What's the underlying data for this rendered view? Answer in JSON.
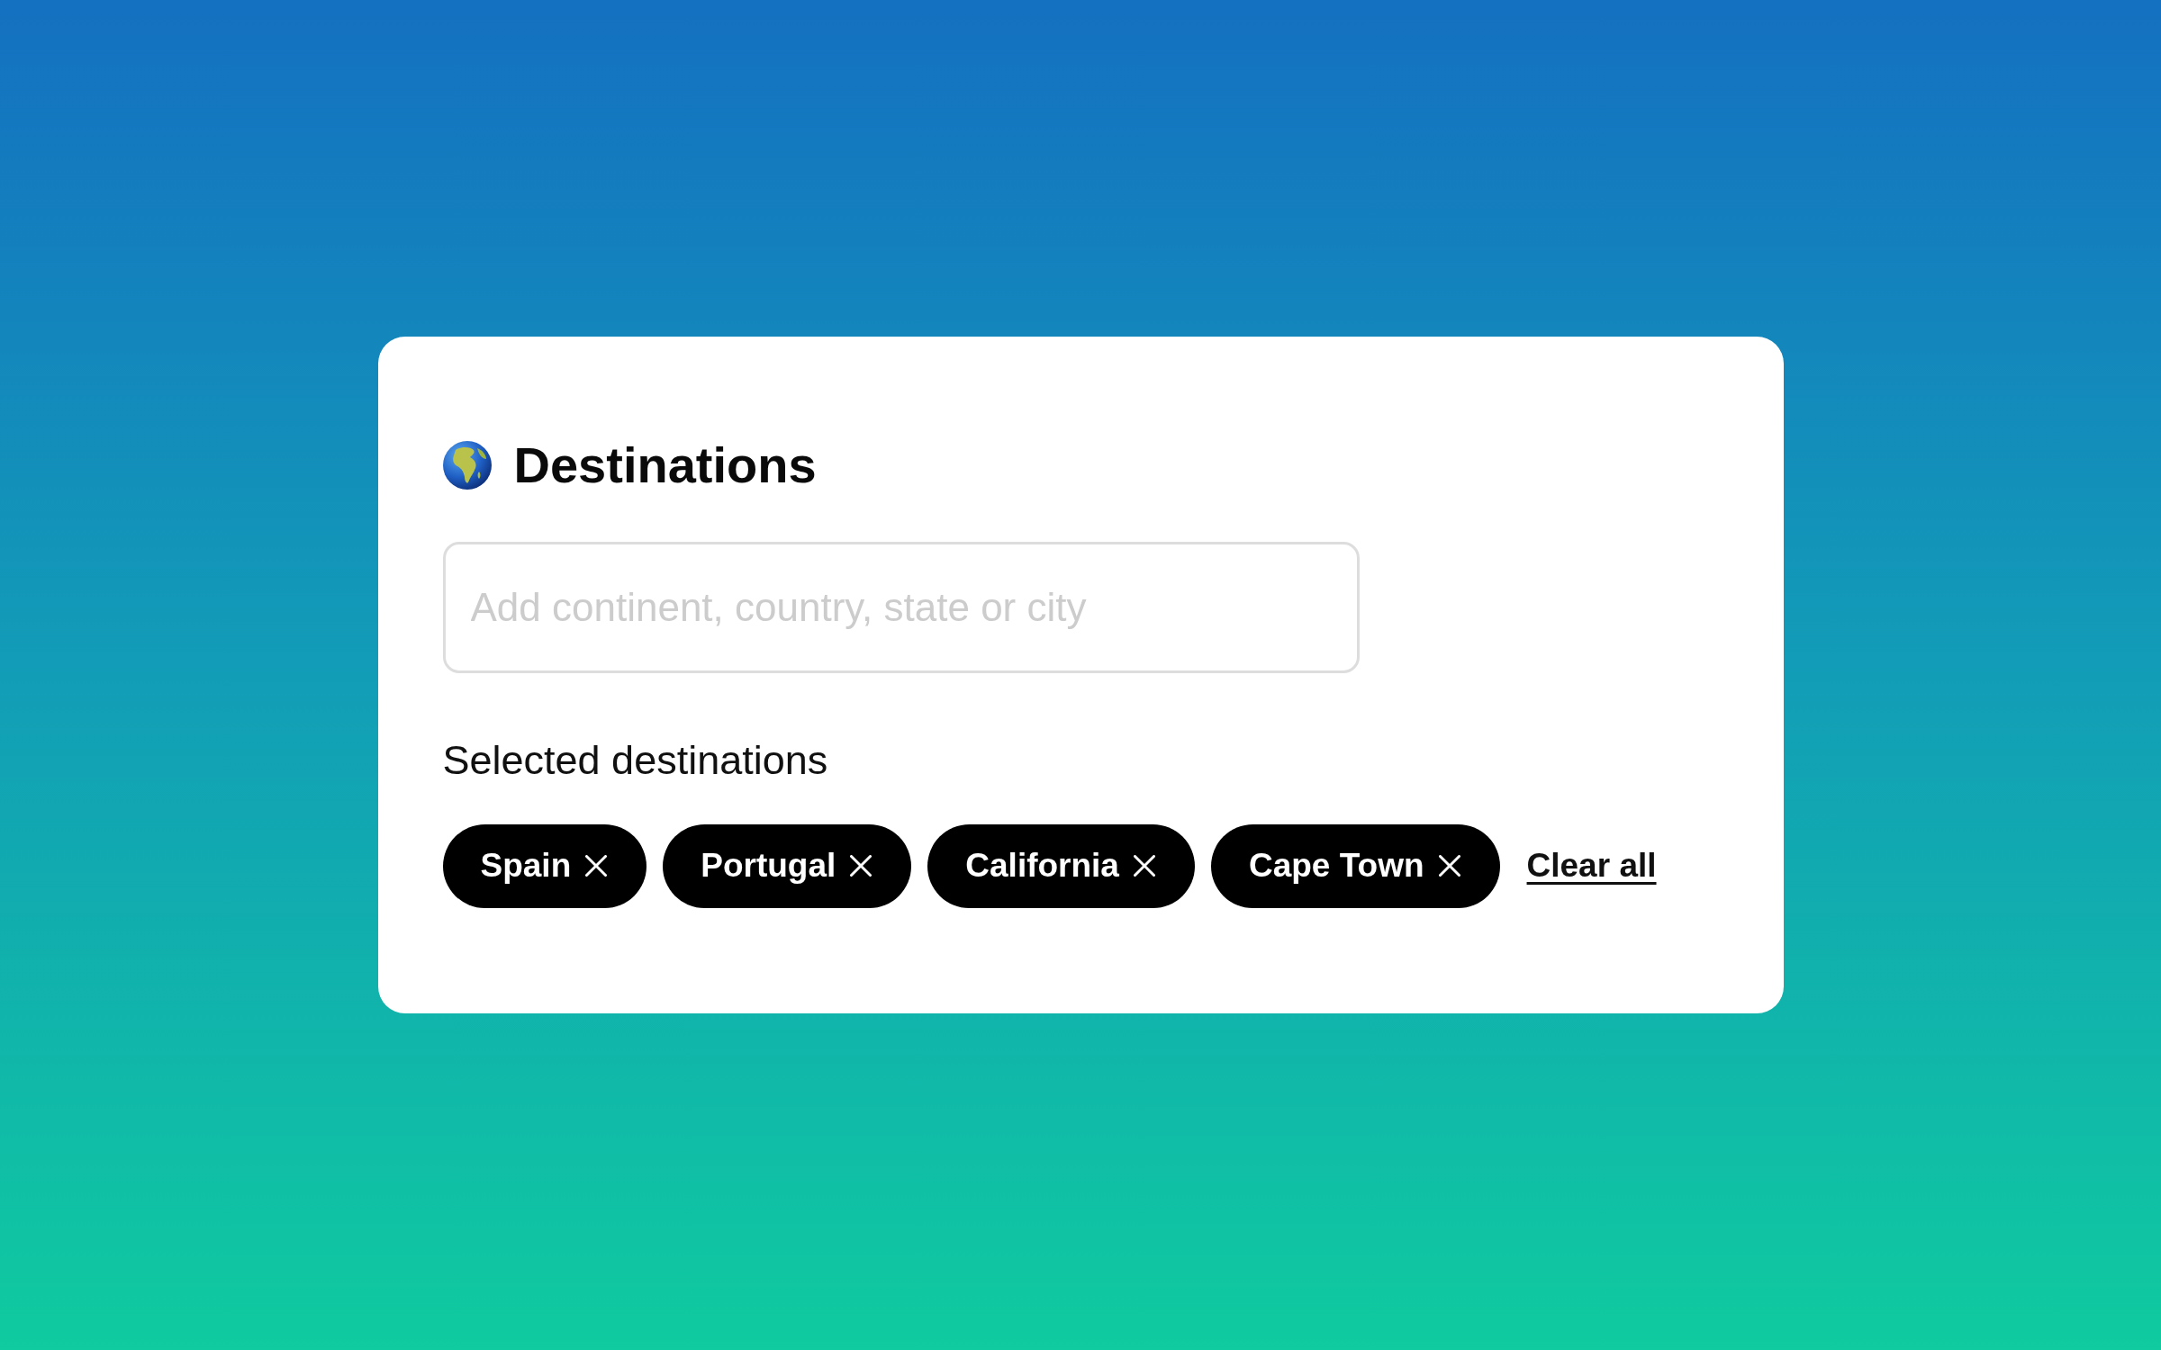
{
  "header": {
    "title": "Destinations"
  },
  "search": {
    "placeholder": "Add continent, country, state or city"
  },
  "selected": {
    "label": "Selected destinations",
    "chips": [
      {
        "label": "Spain"
      },
      {
        "label": "Portugal"
      },
      {
        "label": "California"
      },
      {
        "label": "Cape Town"
      }
    ],
    "clear_link": "Clear all"
  }
}
